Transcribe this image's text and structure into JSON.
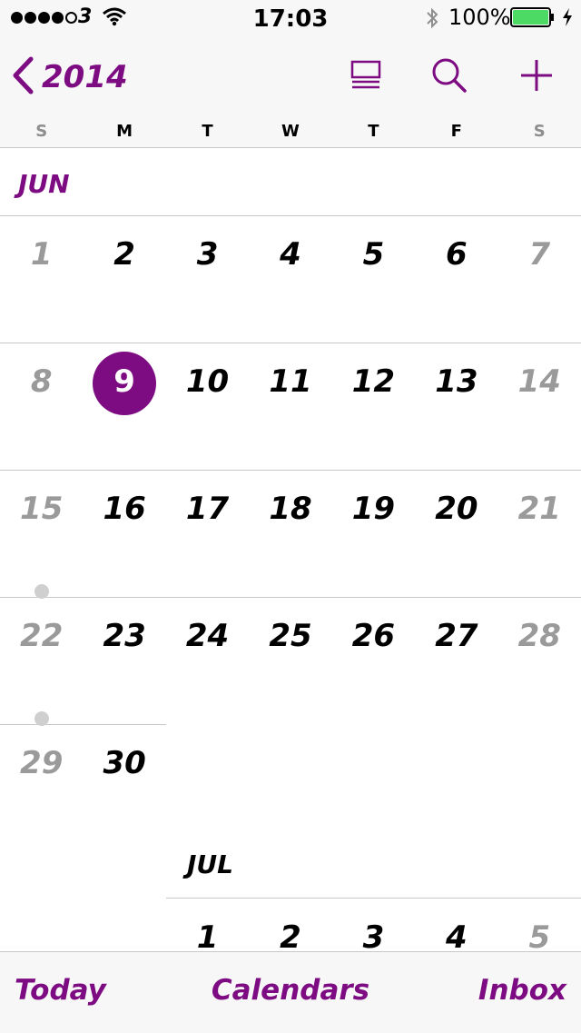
{
  "status_bar": {
    "carrier": "3",
    "time": "17:03",
    "battery_percent": "100%",
    "battery_level": 1.0,
    "signal_bars": 4,
    "signal_total": 5
  },
  "nav": {
    "back_label": "2014",
    "icons": [
      "list-view-icon",
      "search-icon",
      "plus-icon"
    ]
  },
  "weekdays": [
    "S",
    "M",
    "T",
    "W",
    "T",
    "F",
    "S"
  ],
  "months": [
    {
      "label": "JUN",
      "weeks": [
        [
          {
            "day": "1"
          },
          {
            "day": "2"
          },
          {
            "day": "3"
          },
          {
            "day": "4"
          },
          {
            "day": "5"
          },
          {
            "day": "6"
          },
          {
            "day": "7"
          }
        ],
        [
          {
            "day": "8"
          },
          {
            "day": "9",
            "today": true
          },
          {
            "day": "10"
          },
          {
            "day": "11"
          },
          {
            "day": "12"
          },
          {
            "day": "13"
          },
          {
            "day": "14"
          }
        ],
        [
          {
            "day": "15",
            "event": true
          },
          {
            "day": "16"
          },
          {
            "day": "17"
          },
          {
            "day": "18"
          },
          {
            "day": "19"
          },
          {
            "day": "20"
          },
          {
            "day": "21"
          }
        ],
        [
          {
            "day": "22",
            "event": true
          },
          {
            "day": "23"
          },
          {
            "day": "24"
          },
          {
            "day": "25"
          },
          {
            "day": "26"
          },
          {
            "day": "27"
          },
          {
            "day": "28"
          }
        ],
        [
          {
            "day": "29"
          },
          {
            "day": "30"
          }
        ]
      ]
    },
    {
      "label": "JUL",
      "weeks": [
        [
          null,
          null,
          {
            "day": "1"
          },
          {
            "day": "2"
          },
          {
            "day": "3"
          },
          {
            "day": "4"
          },
          {
            "day": "5"
          }
        ]
      ]
    }
  ],
  "toolbar": {
    "today": "Today",
    "calendars": "Calendars",
    "inbox": "Inbox"
  },
  "colors": {
    "accent": "#7d0c82",
    "weekend": "#9a9a9a",
    "event_dot": "#cfcfcf",
    "separator": "#c8c8c8"
  }
}
